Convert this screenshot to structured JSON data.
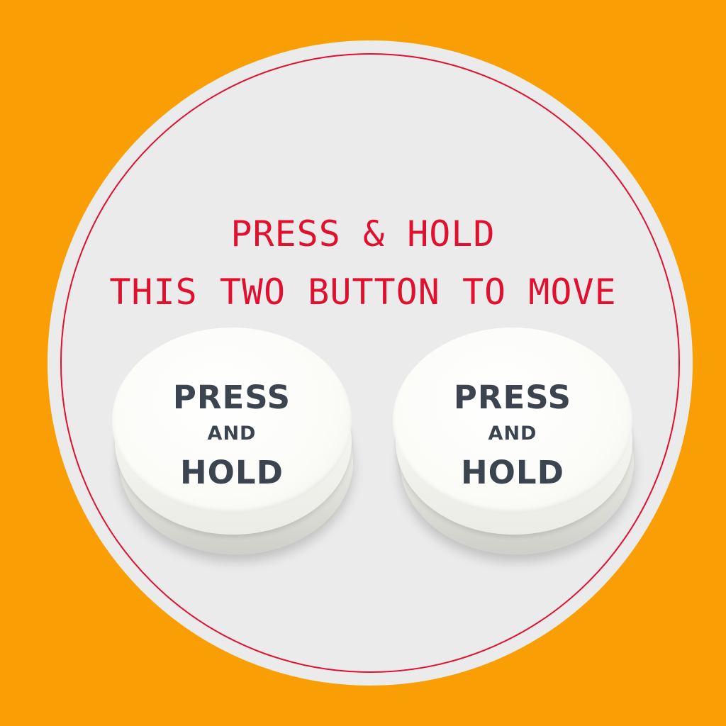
{
  "instruction": {
    "line1": "PRESS & HOLD",
    "line2": "THIS TWO BUTTON TO MOVE"
  },
  "buttons": [
    {
      "line1": "PRESS",
      "line2": "AND",
      "line3": "HOLD"
    },
    {
      "line1": "PRESS",
      "line2": "AND",
      "line3": "HOLD"
    }
  ],
  "colors": {
    "background": "#FA9E05",
    "panel": "#EBEBEB",
    "accent_red": "#E0102E",
    "button_text": "#3C4450"
  }
}
